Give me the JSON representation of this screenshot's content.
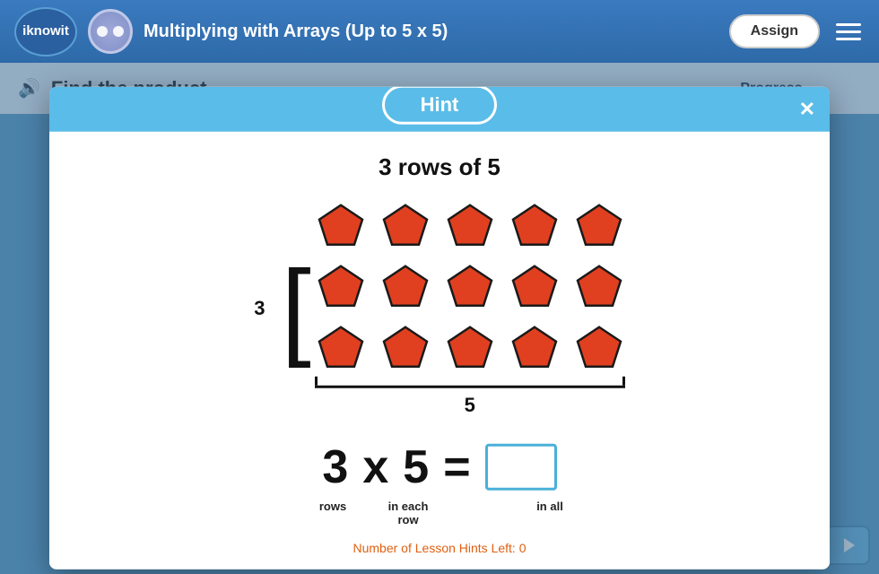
{
  "header": {
    "logo": "iknowit",
    "title": "Multiplying with Arrays (Up to 5 x 5)",
    "assign_label": "Assign"
  },
  "question": {
    "text": "Find the product."
  },
  "progress": {
    "label": "Progress"
  },
  "modal": {
    "title": "Hint",
    "close": "✕",
    "hint_title": "3 rows of 5",
    "row_label": "3",
    "col_label": "5",
    "equation": {
      "rows_num": "3",
      "times": "x",
      "cols_num": "5",
      "equals": "=",
      "label_rows": "rows",
      "label_each": "in each",
      "label_each2": "row",
      "label_all": "in all"
    },
    "hints_left": "Number of Lesson Hints Left: 0"
  }
}
